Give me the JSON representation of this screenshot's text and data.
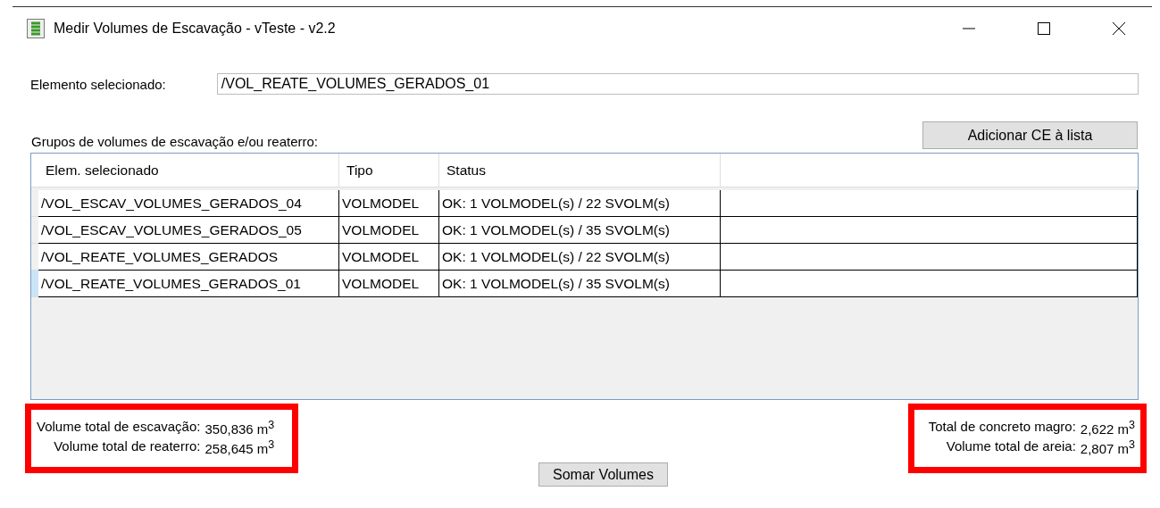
{
  "window": {
    "title": "Medir Volumes de Escavação - vTeste - v2.2"
  },
  "selected_element": {
    "label": "Elemento selecionado:",
    "value": "/VOL_REATE_VOLUMES_GERADOS_01"
  },
  "groups_label": "Grupos de volumes de escavação e/ou reaterro:",
  "add_button": "Adicionar CE à lista",
  "table": {
    "columns": [
      "Elem. selecionado",
      "Tipo",
      "Status"
    ],
    "rows": [
      {
        "cells": [
          "/VOL_ESCAV_VOLUMES_GERADOS_04",
          "VOLMODEL",
          "OK: 1 VOLMODEL(s) / 22 SVOLM(s)"
        ],
        "selected": false
      },
      {
        "cells": [
          "/VOL_ESCAV_VOLUMES_GERADOS_05",
          "VOLMODEL",
          "OK: 1 VOLMODEL(s) / 35 SVOLM(s)"
        ],
        "selected": false
      },
      {
        "cells": [
          "/VOL_REATE_VOLUMES_GERADOS",
          "VOLMODEL",
          "OK: 1 VOLMODEL(s) / 22 SVOLM(s)"
        ],
        "selected": false
      },
      {
        "cells": [
          "/VOL_REATE_VOLUMES_GERADOS_01",
          "VOLMODEL",
          "OK: 1 VOLMODEL(s) / 35 SVOLM(s)"
        ],
        "selected": true
      }
    ]
  },
  "totals_left": [
    {
      "label": "Volume total de escavação:",
      "value": "350,836 m$^{3}$"
    },
    {
      "label": "Volume total de reaterro:",
      "value": "258,645 m$^{3}$"
    }
  ],
  "sum_button": "Somar Volumes",
  "totals_right": [
    {
      "label": "Total de concreto magro:",
      "value": "2,622 m$^{3}$"
    },
    {
      "label": "Volume total de areia:",
      "value": "2,807 m$^{3}$"
    }
  ]
}
